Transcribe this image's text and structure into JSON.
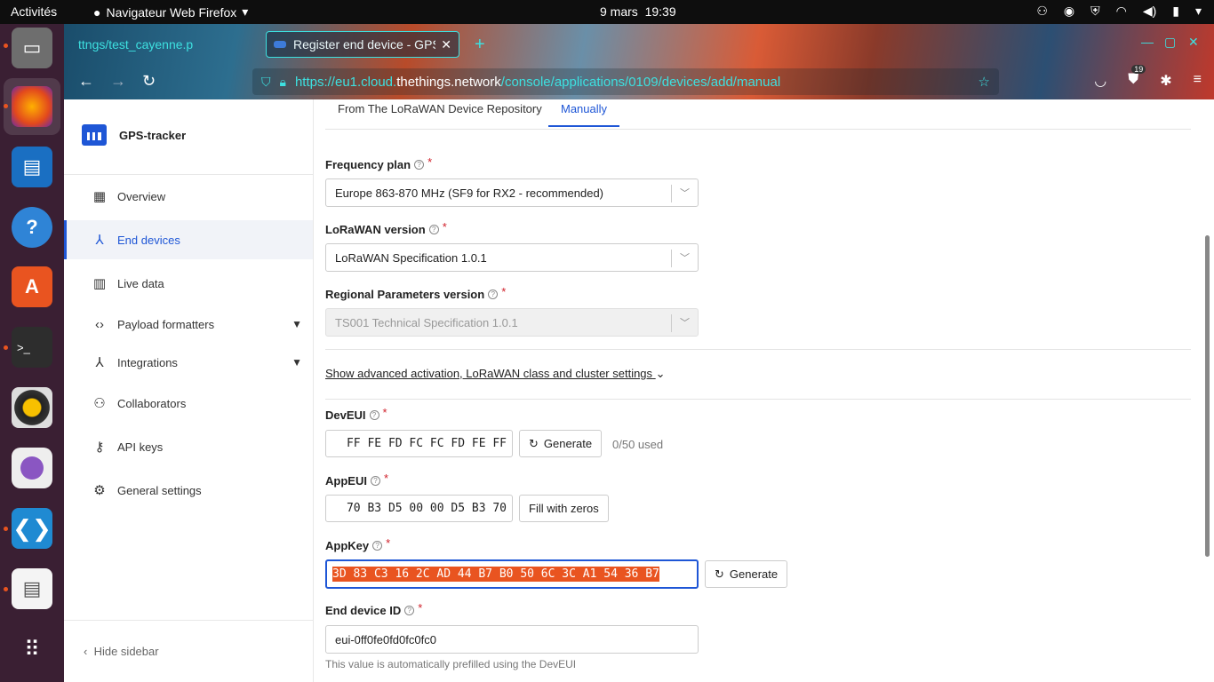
{
  "topbar": {
    "activities": "Activités",
    "app_name": "Navigateur Web Firefox",
    "date": "9 mars",
    "time": "19:39"
  },
  "dock": {
    "items": [
      "files-icon",
      "firefox-icon",
      "writer-icon",
      "help-icon",
      "software-icon",
      "terminal-icon",
      "rhythmbox-icon",
      "screenshot-icon",
      "vscode-icon",
      "document-viewer-icon",
      "app-grid-icon"
    ]
  },
  "browser": {
    "tabs": [
      {
        "label": "ttngs/test_cayenne.p"
      },
      {
        "label": "Register end device - GPS",
        "close": "✕"
      }
    ],
    "url_prefix": "https://eu1.cloud.",
    "url_domain": "thethings.network",
    "url_path": "/console/applications/0109/devices/add/manual",
    "badge_count": "19"
  },
  "sidebar": {
    "app_name": "GPS-tracker",
    "items": [
      {
        "label": "Overview"
      },
      {
        "label": "End devices"
      },
      {
        "label": "Live data"
      },
      {
        "label": "Payload formatters"
      },
      {
        "label": "Integrations"
      },
      {
        "label": "Collaborators"
      },
      {
        "label": "API keys"
      },
      {
        "label": "General settings"
      }
    ],
    "hide_label": "Hide sidebar"
  },
  "main": {
    "tabs": [
      {
        "label": "From The LoRaWAN Device Repository"
      },
      {
        "label": "Manually"
      }
    ],
    "frequency_plan": {
      "label": "Frequency plan",
      "value": "Europe 863-870 MHz (SF9 for RX2 - recommended)"
    },
    "lorawan_version": {
      "label": "LoRaWAN version",
      "value": "LoRaWAN Specification 1.0.1"
    },
    "regional_params": {
      "label": "Regional Parameters version",
      "value": "TS001 Technical Specification 1.0.1"
    },
    "advanced_link": "Show advanced activation, LoRaWAN class and cluster settings",
    "deveui": {
      "label": "DevEUI",
      "value": "FF FE FD FC FC FD FE FF",
      "button": "Generate",
      "used": "0/50 used"
    },
    "appeui": {
      "label": "AppEUI",
      "value": "70 B3 D5 00 00 D5 B3 70",
      "button": "Fill with zeros"
    },
    "appkey": {
      "label": "AppKey",
      "value": "3D 83 C3 16 2C AD 44 B7 B0 50 6C 3C A1 54 36 B7",
      "button": "Generate"
    },
    "end_device_id": {
      "label": "End device ID",
      "value": "eui-0ff0fe0fd0fc0fc0",
      "hint": "This value is automatically prefilled using the DevEUI"
    }
  }
}
